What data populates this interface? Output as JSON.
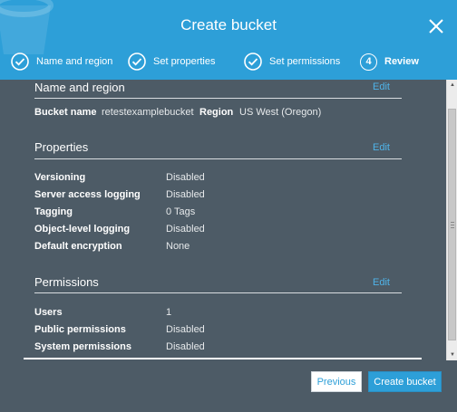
{
  "header": {
    "title": "Create bucket",
    "steps": [
      {
        "label": "Name and region",
        "state": "done",
        "icon": "check-circle-icon"
      },
      {
        "label": "Set properties",
        "state": "done",
        "icon": "check-circle-icon"
      },
      {
        "label": "Set permissions",
        "state": "done",
        "icon": "check-circle-icon"
      },
      {
        "number": "4",
        "label": "Review",
        "state": "current"
      }
    ]
  },
  "sections": {
    "name_region": {
      "title": "Name and region",
      "edit_label": "Edit",
      "bucket_name_label": "Bucket name",
      "bucket_name_value": "retestexamplebucket",
      "region_label": "Region",
      "region_value": "US West (Oregon)"
    },
    "properties": {
      "title": "Properties",
      "edit_label": "Edit",
      "rows": [
        {
          "label": "Versioning",
          "value": "Disabled"
        },
        {
          "label": "Server access logging",
          "value": "Disabled"
        },
        {
          "label": "Tagging",
          "value": "0 Tags"
        },
        {
          "label": "Object-level logging",
          "value": "Disabled"
        },
        {
          "label": "Default encryption",
          "value": "None"
        }
      ]
    },
    "permissions": {
      "title": "Permissions",
      "edit_label": "Edit",
      "rows": [
        {
          "label": "Users",
          "value": "1"
        },
        {
          "label": "Public permissions",
          "value": "Disabled"
        },
        {
          "label": "System permissions",
          "value": "Disabled"
        }
      ]
    }
  },
  "footer": {
    "previous_label": "Previous",
    "create_label": "Create bucket"
  },
  "colors": {
    "header_blue": "#2d9fd8",
    "panel_slate": "#4d5b66",
    "link_blue": "#4fb3e8"
  }
}
